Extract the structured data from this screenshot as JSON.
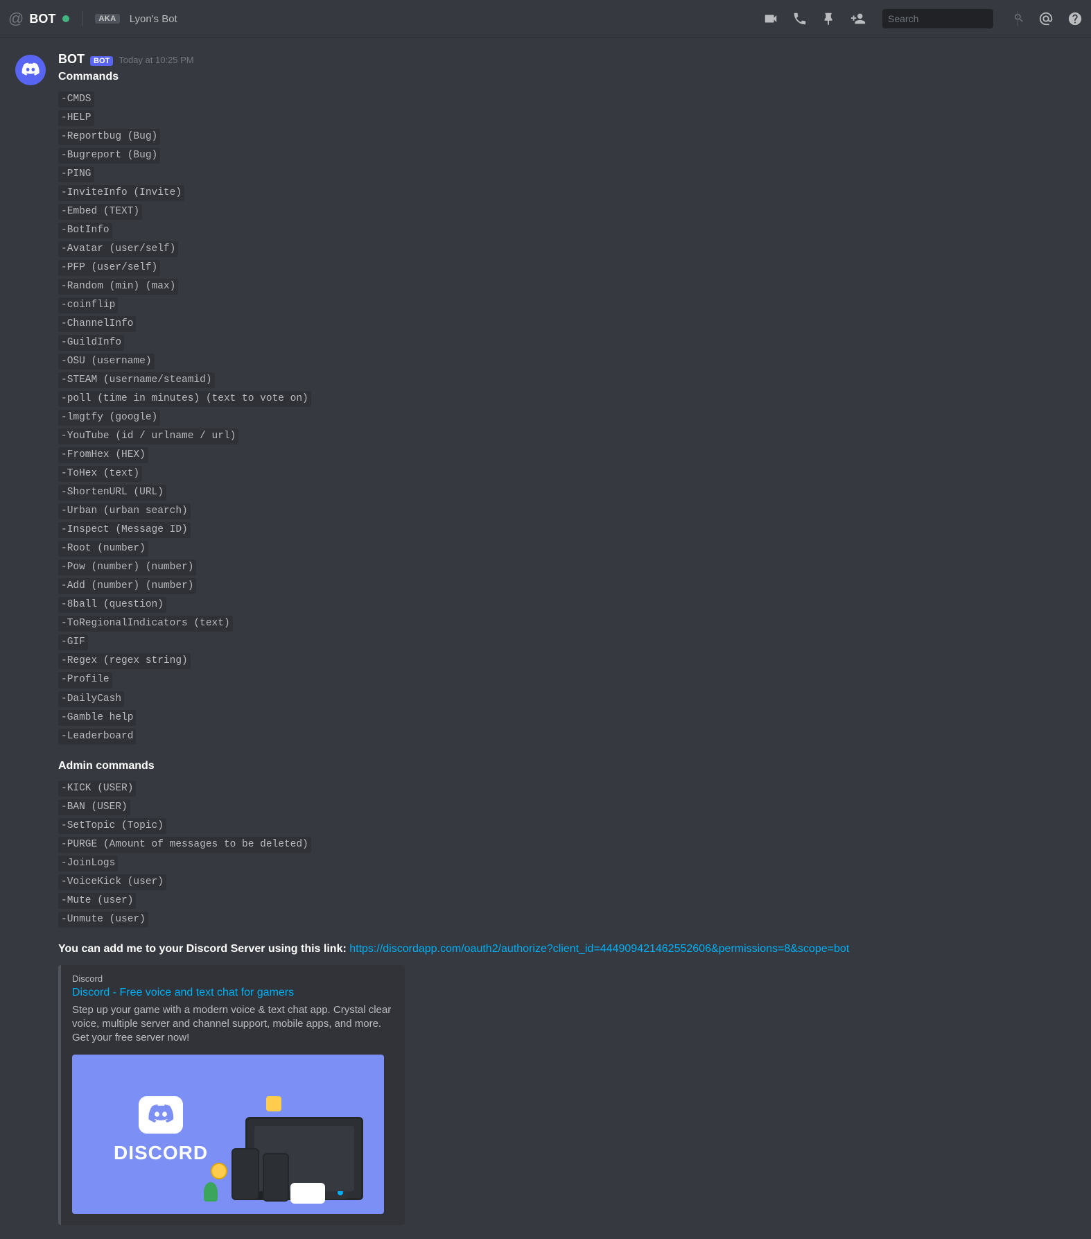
{
  "header": {
    "at": "@",
    "channel": "BOT",
    "aka": "AKA",
    "topic": "Lyon's Bot"
  },
  "search": {
    "placeholder": "Search"
  },
  "message": {
    "username": "BOT",
    "bot_tag": "BOT",
    "timestamp": "Today at 10:25 PM",
    "commands_title": "Commands",
    "commands": [
      "-CMDS",
      "-HELP",
      "-Reportbug (Bug)",
      "-Bugreport (Bug)",
      "-PING",
      "-InviteInfo (Invite)",
      "-Embed (TEXT)",
      "-BotInfo",
      "-Avatar (user/self)",
      "-PFP (user/self)",
      "-Random (min) (max)",
      "-coinflip",
      "-ChannelInfo",
      "-GuildInfo",
      "-OSU (username)",
      "-STEAM (username/steamid)",
      "-poll (time in minutes) (text to vote on)",
      "-lmgtfy (google)",
      "-YouTube (id / urlname / url)",
      "-FromHex (HEX)",
      "-ToHex (text)",
      "-ShortenURL (URL)",
      "-Urban (urban search)",
      "-Inspect (Message ID)",
      "-Root (number)",
      "-Pow (number) (number)",
      "-Add (number) (number)",
      "-8ball (question)",
      "-ToRegionalIndicators (text)",
      "-GIF",
      "-Regex (regex string)",
      "-Profile",
      "-DailyCash",
      "-Gamble help",
      "-Leaderboard"
    ],
    "admin_title": "Admin commands",
    "admin_commands": [
      "-KICK (USER)",
      "-BAN (USER)",
      "-SetTopic (Topic)",
      "-PURGE (Amount of messages to be deleted)",
      "-JoinLogs",
      "-VoiceKick (user)",
      "-Mute (user)",
      "-Unmute (user)"
    ],
    "link_label": "You can add me to your Discord Server using this link: ",
    "link_url": "https://discordapp.com/oauth2/authorize?client_id=444909421462552606&permissions=8&scope=bot"
  },
  "card": {
    "provider": "Discord",
    "title": "Discord - Free voice and text chat for gamers",
    "description": "Step up your game with a modern voice & text chat app. Crystal clear voice, multiple server and channel support, mobile apps, and more. Get your free server now!",
    "logo_word": "DISCORD"
  }
}
